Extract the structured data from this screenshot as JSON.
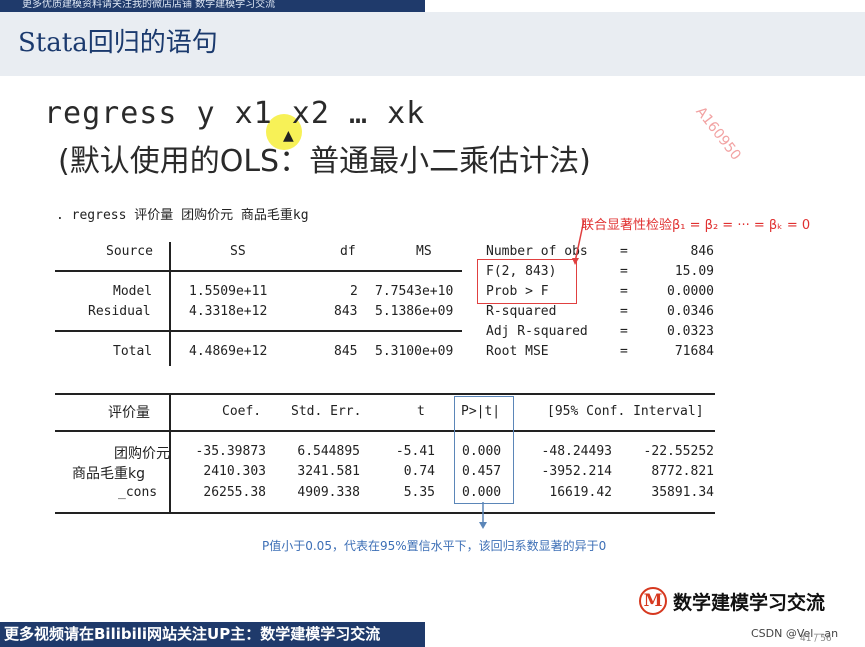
{
  "banner": {
    "top_text": "更多优质建模资料请关注我的微店店铺 数学建模学习交流",
    "bottom_text": "更多视频请在Bilibili网站关注UP主：数学建模学习交流"
  },
  "slide": {
    "title": "Stata回归的语句",
    "command": "regress y x1 x2 … xk",
    "command_desc": "(默认使用的OLS：普通最小二乘估计法)",
    "watermark": "A160950",
    "page_number": "41 / 56",
    "csdn": "CSDN @Vel",
    "csdn2": "an"
  },
  "stata": {
    "command": ". regress 评价量 团购价元 商品毛重kg",
    "anova_headers": [
      "Source",
      "SS",
      "df",
      "MS"
    ],
    "anova_rows": [
      {
        "source": "Model",
        "ss": "1.5509e+11",
        "df": "2",
        "ms": "7.7543e+10"
      },
      {
        "source": "Residual",
        "ss": "4.3318e+12",
        "df": "843",
        "ms": "5.1386e+09"
      },
      {
        "source": "Total",
        "ss": "4.4869e+12",
        "df": "845",
        "ms": "5.3100e+09"
      }
    ],
    "stats": [
      {
        "label": "Number of obs",
        "eq": "=",
        "value": "846"
      },
      {
        "label": "F(2, 843)",
        "eq": "=",
        "value": "15.09"
      },
      {
        "label": "Prob > F",
        "eq": "=",
        "value": "0.0000"
      },
      {
        "label": "R-squared",
        "eq": "=",
        "value": "0.0346"
      },
      {
        "label": "Adj R-squared",
        "eq": "=",
        "value": "0.0323"
      },
      {
        "label": "Root MSE",
        "eq": "=",
        "value": "71684"
      }
    ],
    "coef_headers": {
      "dep": "评价量",
      "coef": "Coef.",
      "se": "Std. Err.",
      "t": "t",
      "p": "P>|t|",
      "ci": "[95% Conf. Interval]"
    },
    "coef_rows": [
      {
        "var": "团购价元",
        "coef": "-35.39873",
        "se": "6.544895",
        "t": "-5.41",
        "p": "0.000",
        "lo": "-48.24493",
        "hi": "-22.55252"
      },
      {
        "var": "商品毛重kg",
        "coef": "2410.303",
        "se": "3241.581",
        "t": "0.74",
        "p": "0.457",
        "lo": "-3952.214",
        "hi": "8772.821"
      },
      {
        "var": "_cons",
        "coef": "26255.38",
        "se": "4909.338",
        "t": "5.35",
        "p": "0.000",
        "lo": "16619.42",
        "hi": "35891.34"
      }
    ]
  },
  "annotations": {
    "f_test": "联合显著性检验β₁ = β₂ = ··· = βₖ = 0",
    "p_value": "P值小于0.05，代表在95%置信水平下，该回归系数显著的异于0"
  },
  "logo": {
    "letter": "M",
    "text": "数学建模学习交流"
  },
  "colors": {
    "banner": "#1f3a6b",
    "title": "#1b3a6e",
    "red": "#e04040",
    "blue": "#5b86b8"
  }
}
